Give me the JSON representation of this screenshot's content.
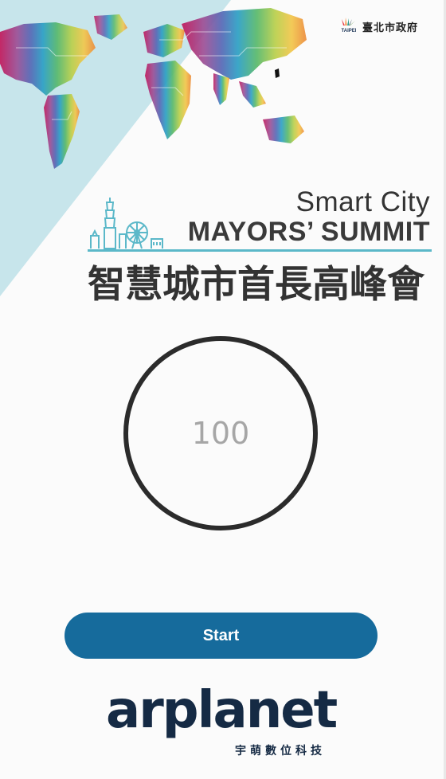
{
  "header": {
    "gov_name": "臺北市政府",
    "gov_logo_text": "TAIPEI"
  },
  "event": {
    "title_line1": "Smart City",
    "title_line2": "MAYORS’ SUMMIT",
    "title_cn": "智慧城市首長高峰會"
  },
  "counter": {
    "value": "100"
  },
  "actions": {
    "start_label": "Start"
  },
  "footer": {
    "brand": "arplanet",
    "brand_cn": "宇萌數位科技"
  },
  "colors": {
    "accent": "#166b9c",
    "triangle": "#c5e4ea",
    "ring": "#2b2b2b",
    "brand": "#152a44",
    "summit_rule": "#5bb8c9"
  },
  "icons": [
    "taipei-logo-icon",
    "world-map-icon",
    "skyline-icon"
  ]
}
